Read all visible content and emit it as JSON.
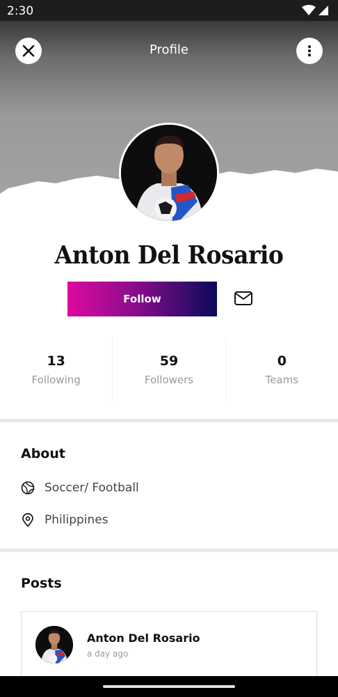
{
  "status_bar": {
    "time": "2:30",
    "icons": [
      "wifi-icon",
      "signal-icon"
    ]
  },
  "header": {
    "title": "Profile",
    "close_icon": "close-icon",
    "more_icon": "more-vertical-icon"
  },
  "profile": {
    "name": "Anton Del Rosario",
    "follow_label": "Follow",
    "message_icon": "mail-icon"
  },
  "stats": [
    {
      "value": "13",
      "label": "Following"
    },
    {
      "value": "59",
      "label": "Followers"
    },
    {
      "value": "0",
      "label": "Teams"
    }
  ],
  "about": {
    "title": "About",
    "sport": "Soccer/ Football",
    "location": "Philippines"
  },
  "posts": {
    "title": "Posts",
    "items": [
      {
        "author": "Anton Del Rosario",
        "time": "a day ago"
      }
    ]
  },
  "colors": {
    "follow_gradient_start": "#dc0aa0",
    "follow_gradient_end": "#0a0a5a",
    "cover_gray": "#9a9a9a",
    "muted_text": "#9a9a9a"
  }
}
